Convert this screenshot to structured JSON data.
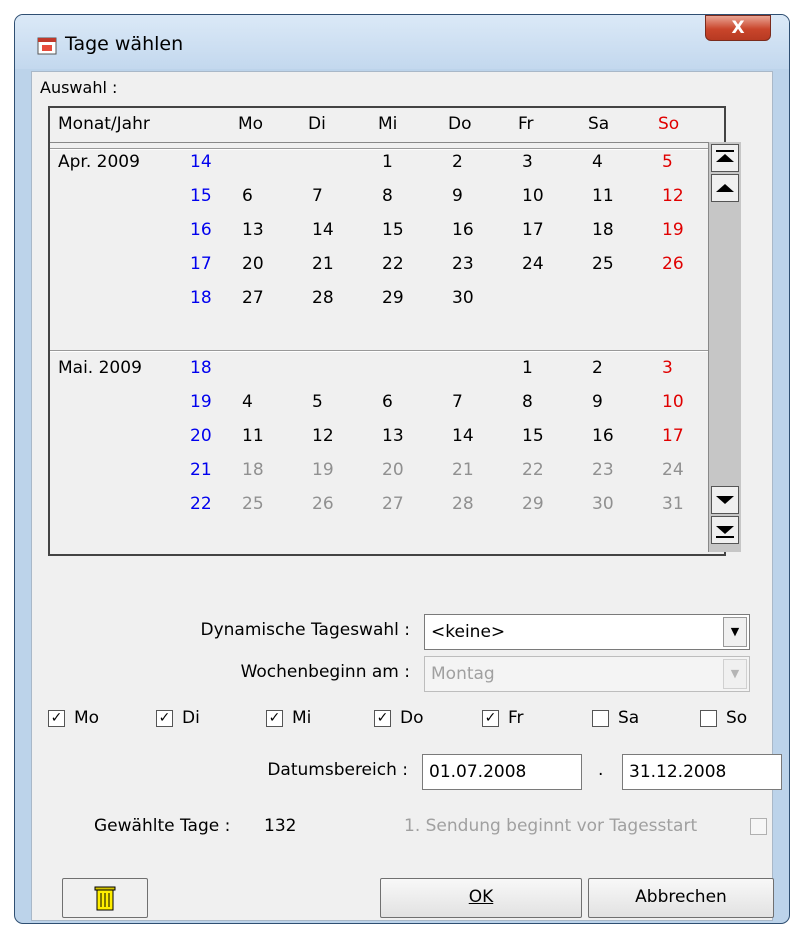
{
  "window": {
    "title": "Tage wählen",
    "close_label": "X"
  },
  "auswahl_label": "Auswahl :",
  "calendar": {
    "headers": [
      "Monat/Jahr",
      "Mo",
      "Di",
      "Mi",
      "Do",
      "Fr",
      "Sa",
      "So"
    ],
    "months": [
      {
        "label": "Apr. 2009",
        "weeks": [
          {
            "kw": "14",
            "days": [
              "",
              "",
              "1",
              "2",
              "3",
              "4",
              "5"
            ]
          },
          {
            "kw": "15",
            "days": [
              "6",
              "7",
              "8",
              "9",
              "10",
              "11",
              "12"
            ]
          },
          {
            "kw": "16",
            "days": [
              "13",
              "14",
              "15",
              "16",
              "17",
              "18",
              "19"
            ]
          },
          {
            "kw": "17",
            "days": [
              "20",
              "21",
              "22",
              "23",
              "24",
              "25",
              "26"
            ]
          },
          {
            "kw": "18",
            "days": [
              "27",
              "28",
              "29",
              "30",
              "",
              "",
              ""
            ]
          }
        ]
      },
      {
        "label": "Mai. 2009",
        "weeks": [
          {
            "kw": "18",
            "days": [
              "",
              "",
              "",
              "",
              "1",
              "2",
              "3"
            ]
          },
          {
            "kw": "19",
            "days": [
              "4",
              "5",
              "6",
              "7",
              "8",
              "9",
              "10"
            ]
          },
          {
            "kw": "20",
            "days": [
              "11",
              "12",
              "13",
              "14",
              "15",
              "16",
              "17"
            ]
          },
          {
            "kw": "21",
            "days": [
              "18",
              "19",
              "20",
              "21",
              "22",
              "23",
              "24"
            ],
            "greyed": true
          },
          {
            "kw": "22",
            "days": [
              "25",
              "26",
              "27",
              "28",
              "29",
              "30",
              "31"
            ],
            "greyed": true
          }
        ]
      }
    ]
  },
  "colors": {
    "week_number": "#0000ee",
    "sunday": "#e00000",
    "greyed_day": "#909090"
  },
  "form": {
    "dynamic_label": "Dynamische Tageswahl :",
    "dynamic_value": "<keine>",
    "week_start_label": "Wochenbeginn am :",
    "week_start_value": "Montag",
    "weekdays": [
      {
        "label": "Mo",
        "checked": true
      },
      {
        "label": "Di",
        "checked": true
      },
      {
        "label": "Mi",
        "checked": true
      },
      {
        "label": "Do",
        "checked": true
      },
      {
        "label": "Fr",
        "checked": true
      },
      {
        "label": "Sa",
        "checked": false
      },
      {
        "label": "So",
        "checked": false
      }
    ],
    "range_label": "Datumsbereich :",
    "range_from": "01.07.2008",
    "range_separator": ".",
    "range_to": "31.12.2008",
    "selected_days_label": "Gewählte Tage :",
    "selected_days_value": "132",
    "first_show_label": "1. Sendung beginnt vor Tagesstart",
    "first_show_checked": false
  },
  "buttons": {
    "ok": "OK",
    "cancel": "Abbrechen",
    "delete_icon": "trash-icon"
  }
}
